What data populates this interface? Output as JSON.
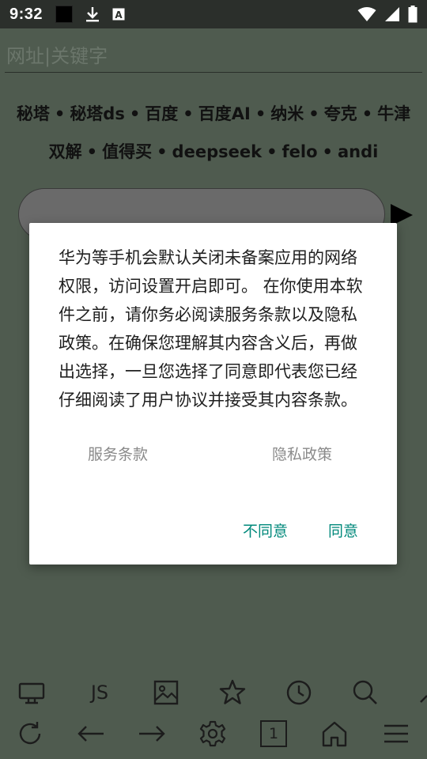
{
  "status_bar": {
    "time": "9:32",
    "left_icons": [
      "black-square-icon",
      "download-icon",
      "font-a-icon"
    ],
    "right_icons": [
      "wifi-icon",
      "signal-icon",
      "battery-icon"
    ],
    "font_icon_letter": "A"
  },
  "url_bar": {
    "placeholder": "网址|关键字",
    "value": ""
  },
  "quick_links": {
    "separator": "•",
    "items": [
      "秘塔",
      "秘塔ds",
      "百度",
      "百度AI",
      "纳米",
      "夸克",
      "牛津双解",
      "值得买",
      "deepseek",
      "felo",
      "andi"
    ]
  },
  "search_box": {
    "value": ""
  },
  "dialog": {
    "message": "华为等手机会默认关闭未备案应用的网络权限，访问设置开启即可。 在你使用本软件之前，请你务必阅读服务条款以及隐私政策。在确保您理解其内容含义后，再做出选择，一旦您选择了同意即代表您已经仔细阅读了用户协议并接受其内容条款。",
    "terms_link": "服务条款",
    "privacy_link": "隐私政策",
    "disagree_label": "不同意",
    "agree_label": "同意"
  },
  "toolbar_top": {
    "items": [
      "desktop-icon",
      "JS",
      "image-icon",
      "star-icon",
      "clock-icon",
      "search-icon",
      "partial-icon"
    ]
  },
  "toolbar_bottom": {
    "items": [
      "refresh-icon",
      "back-arrow-icon",
      "forward-arrow-icon",
      "settings-icon",
      "tab-count",
      "home-icon",
      "menu-icon"
    ],
    "tab_count": "1",
    "js_label": "JS"
  },
  "colors": {
    "overlay_bg": "#4f5b4f",
    "status_bar_bg": "#2b2f2b",
    "accent": "#00897b",
    "link_gray": "#8a8a8a"
  }
}
